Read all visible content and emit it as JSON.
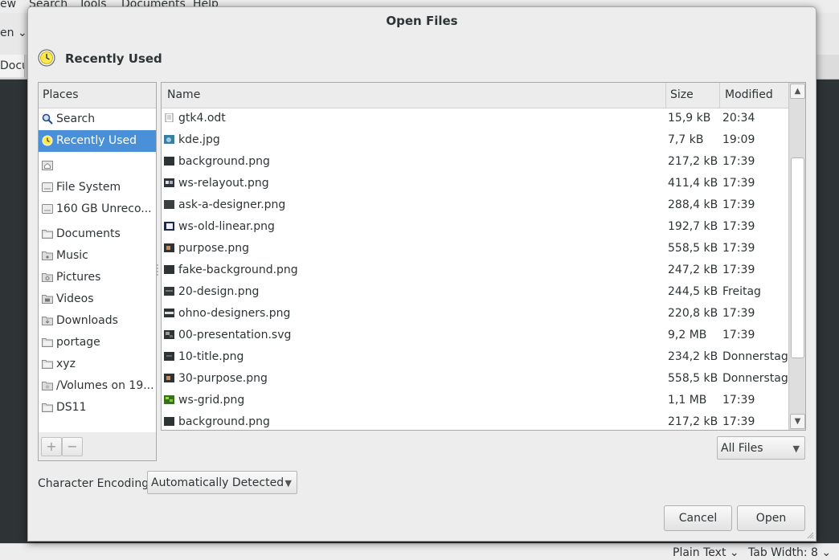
{
  "background_app": {
    "menu": [
      "ew",
      "Search",
      "Tools",
      "Documents",
      "Help"
    ],
    "toolbar_open_label": "en",
    "tab_label": "Docu",
    "status": {
      "language": "Plain Text",
      "tab_width": "Tab Width: 8"
    }
  },
  "dialog": {
    "title": "Open Files",
    "location": "Recently Used",
    "places_header": "Places",
    "places": [
      {
        "label": "Search",
        "icon": "search-icon"
      },
      {
        "label": "Recently Used",
        "icon": "clock-icon",
        "selected": true
      },
      {
        "label": "",
        "icon": "home-icon"
      },
      {
        "label": "File System",
        "icon": "drive-icon"
      },
      {
        "label": "160 GB Unreco...",
        "icon": "drive-icon"
      },
      {
        "label": "Documents",
        "icon": "folder-icon"
      },
      {
        "label": "Music",
        "icon": "folder-music-icon"
      },
      {
        "label": "Pictures",
        "icon": "folder-pictures-icon"
      },
      {
        "label": "Videos",
        "icon": "folder-videos-icon"
      },
      {
        "label": "Downloads",
        "icon": "folder-downloads-icon"
      },
      {
        "label": "portage",
        "icon": "folder-icon"
      },
      {
        "label": "xyz",
        "icon": "folder-icon"
      },
      {
        "label": "/Volumes on 19...",
        "icon": "network-folder-icon"
      },
      {
        "label": "DS11",
        "icon": "folder-icon"
      }
    ],
    "columns": {
      "name": "Name",
      "size": "Size",
      "modified": "Modified"
    },
    "files": [
      {
        "name": "gtk4.odt",
        "size": "15,9 kB",
        "modified": "20:34",
        "icon": "document-icon"
      },
      {
        "name": "kde.jpg",
        "size": "7,7 kB",
        "modified": "19:09",
        "icon": "image-thumb-icon"
      },
      {
        "name": "background.png",
        "size": "217,2 kB",
        "modified": "17:39",
        "icon": "image-thumb-icon"
      },
      {
        "name": "ws-relayout.png",
        "size": "411,4 kB",
        "modified": "17:39",
        "icon": "image-thumb-icon"
      },
      {
        "name": "ask-a-designer.png",
        "size": "288,4 kB",
        "modified": "17:39",
        "icon": "image-thumb-icon"
      },
      {
        "name": "ws-old-linear.png",
        "size": "192,7 kB",
        "modified": "17:39",
        "icon": "image-thumb-icon"
      },
      {
        "name": "purpose.png",
        "size": "558,5 kB",
        "modified": "17:39",
        "icon": "image-thumb-icon"
      },
      {
        "name": "fake-background.png",
        "size": "247,2 kB",
        "modified": "17:39",
        "icon": "image-thumb-icon"
      },
      {
        "name": "20-design.png",
        "size": "244,5 kB",
        "modified": "Freitag",
        "icon": "image-thumb-icon"
      },
      {
        "name": "ohno-designers.png",
        "size": "220,8 kB",
        "modified": "17:39",
        "icon": "image-thumb-icon"
      },
      {
        "name": "00-presentation.svg",
        "size": "9,2 MB",
        "modified": "17:39",
        "icon": "image-thumb-icon"
      },
      {
        "name": "10-title.png",
        "size": "234,2 kB",
        "modified": "Donnerstag",
        "icon": "image-thumb-icon"
      },
      {
        "name": "30-purpose.png",
        "size": "558,5 kB",
        "modified": "Donnerstag",
        "icon": "image-thumb-icon"
      },
      {
        "name": "ws-grid.png",
        "size": "1,1 MB",
        "modified": "17:39",
        "icon": "image-thumb-icon"
      },
      {
        "name": "background.png",
        "size": "217,2 kB",
        "modified": "17:39",
        "icon": "image-thumb-icon"
      }
    ],
    "filter": "All Files",
    "encoding_label": "Character Encoding:",
    "encoding_value": "Automatically Detected",
    "buttons": {
      "cancel": "Cancel",
      "open": "Open"
    },
    "add_label": "+",
    "remove_label": "−"
  }
}
